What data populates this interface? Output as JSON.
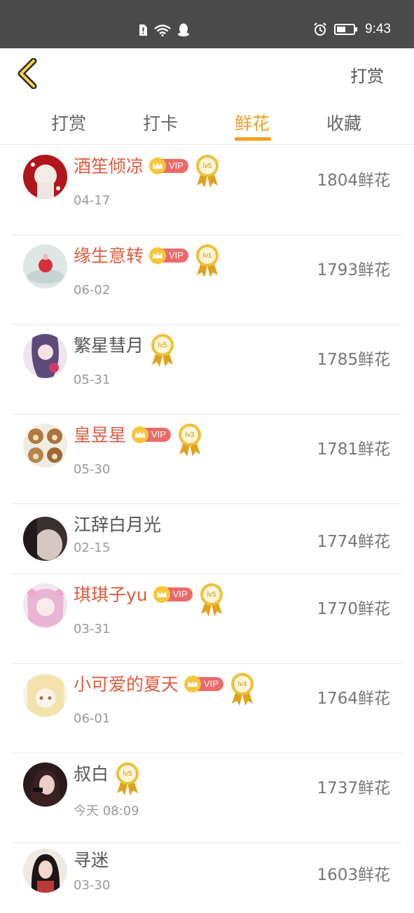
{
  "status_bar": {
    "time": "9:43"
  },
  "header": {
    "action_label": "打赏"
  },
  "tabs": [
    {
      "label": "打赏",
      "active": false
    },
    {
      "label": "打卡",
      "active": false
    },
    {
      "label": "鲜花",
      "active": true
    },
    {
      "label": "收藏",
      "active": false
    }
  ],
  "colors": {
    "accent": "#f0a020",
    "vip_name": "#e05a3c",
    "vip_badge": "#ec6a6a",
    "status_bar": "#4a4a4a"
  },
  "rows": [
    {
      "name": "酒笙倾凉",
      "vip": true,
      "vip_label": "VIP",
      "level": "lv5",
      "date": "04-17",
      "count": "1804鲜花"
    },
    {
      "name": "缘生意转",
      "vip": true,
      "vip_label": "VIP",
      "level": "lv1",
      "date": "06-02",
      "count": "1793鲜花"
    },
    {
      "name": "繁星彗月",
      "vip": false,
      "level": "lv5",
      "date": "05-31",
      "count": "1785鲜花"
    },
    {
      "name": "皇昱星",
      "vip": true,
      "vip_label": "VIP",
      "level": "lv3",
      "date": "05-30",
      "count": "1781鲜花"
    },
    {
      "name": "江辞白月光",
      "vip": false,
      "level": null,
      "date": "02-15",
      "count": "1774鲜花"
    },
    {
      "name": "琪琪子yu",
      "vip": true,
      "vip_label": "VIP",
      "level": "lv5",
      "date": "03-31",
      "count": "1770鲜花"
    },
    {
      "name": "小可爱的夏天",
      "vip": true,
      "vip_label": "VIP",
      "level": "lv4",
      "date": "06-01",
      "count": "1764鲜花"
    },
    {
      "name": "叔白",
      "vip": false,
      "level": "lv5",
      "date": "今天 08:09",
      "count": "1737鲜花"
    },
    {
      "name": "寻迷",
      "vip": false,
      "level": null,
      "date": "03-30",
      "count": "1603鲜花"
    }
  ]
}
